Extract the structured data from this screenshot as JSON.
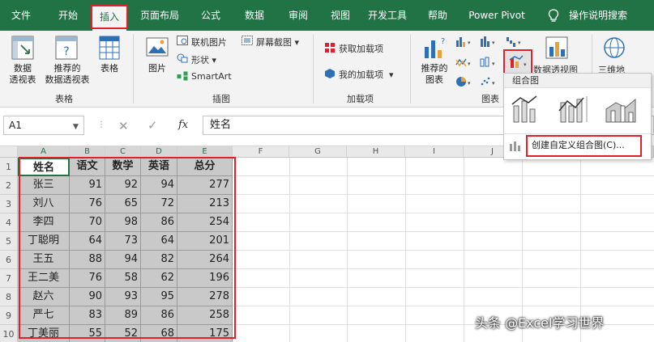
{
  "menu": {
    "tabs": [
      "文件",
      "开始",
      "插入",
      "页面布局",
      "公式",
      "数据",
      "审阅",
      "视图",
      "开发工具",
      "帮助",
      "Power Pivot"
    ],
    "active_tab": "插入",
    "tell_me": "操作说明搜索"
  },
  "ribbon": {
    "groups": {
      "tables": "表格",
      "illustrations": "插图",
      "addins": "加载项",
      "charts": "图表"
    },
    "buttons": {
      "pivot_table": [
        "数据",
        "透视表"
      ],
      "recommended_pivot": [
        "推荐的",
        "数据透视表"
      ],
      "table": "表格",
      "picture": "图片",
      "online_picture": "联机图片",
      "shapes": "形状",
      "screenshot": "屏幕截图",
      "smartart": "SmartArt",
      "get_addins": "获取加载项",
      "my_addins": "我的加载项",
      "recommended_charts": [
        "推荐的",
        "图表"
      ],
      "pivot_chart_partial": "数据透视图",
      "threed_map_partial": "三维地"
    }
  },
  "formula_bar": {
    "name_box": "A1",
    "content": "姓名",
    "fx": "fx"
  },
  "dropdown": {
    "title": "组合图",
    "custom_combo": "创建自定义组合图(C)..."
  },
  "sheet": {
    "columns": [
      "A",
      "B",
      "C",
      "D",
      "E",
      "F",
      "G",
      "H",
      "I",
      "J"
    ],
    "rows": [
      "1",
      "2",
      "3",
      "4",
      "5",
      "6",
      "7",
      "8",
      "9",
      "10"
    ],
    "header": [
      "姓名",
      "语文",
      "数学",
      "英语",
      "总分"
    ],
    "data": [
      [
        "张三",
        "91",
        "92",
        "94",
        "277"
      ],
      [
        "刘八",
        "76",
        "65",
        "72",
        "213"
      ],
      [
        "李四",
        "70",
        "98",
        "86",
        "254"
      ],
      [
        "丁聪明",
        "64",
        "73",
        "64",
        "201"
      ],
      [
        "王五",
        "88",
        "94",
        "82",
        "264"
      ],
      [
        "王二美",
        "76",
        "58",
        "62",
        "196"
      ],
      [
        "赵六",
        "90",
        "93",
        "95",
        "278"
      ],
      [
        "严七",
        "83",
        "89",
        "86",
        "258"
      ],
      [
        "丁美丽",
        "55",
        "52",
        "68",
        "175"
      ]
    ]
  },
  "watermark": "头条 @Excel学习世界",
  "colors": {
    "excel_green": "#217346",
    "highlight_red": "#e0202a",
    "selection_gray": "#c9c9c9"
  }
}
